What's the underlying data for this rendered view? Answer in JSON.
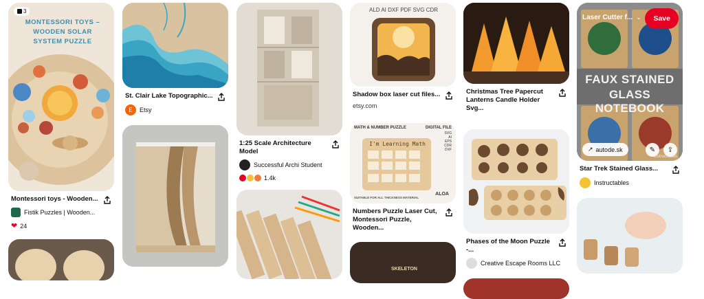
{
  "pins": [
    {
      "id": "montessori",
      "badge_count": "3",
      "image_text": "MONTESSORI TOYS – WOODEN SOLAR SYSTEM PUZZLE",
      "title": "Montessori toys - Wooden...",
      "source": "Fistik Puzzles | Wooden...",
      "reactions": "24"
    },
    {
      "id": "stclair",
      "title": "St. Clair Lake Topographic...",
      "source": "Etsy",
      "avatar_letter": "E"
    },
    {
      "id": "architecture",
      "title": "1:25 Scale Architecture Model",
      "source": "Successful Archi Student",
      "reactions": "1.4k"
    },
    {
      "id": "shadowbox",
      "image_text": "ALD AI DXF PDF SVG CDR",
      "title": "Shadow box laser cut files...",
      "url": "etsy.com"
    },
    {
      "id": "christmas",
      "title": "Christmas Tree Papercut Lanterns Candle Holder Svg..."
    },
    {
      "id": "startrek",
      "board_label": "Laser Cutter f...",
      "save_label": "Save",
      "image_text_1": "FAUX STAINED",
      "image_text_2": "GLASS NOTEBOOK",
      "link_label": "autode.sk",
      "watermark": "instructables",
      "title": "Star Trek Stained Glass...",
      "source": "Instructables"
    },
    {
      "id": "math",
      "image_text_header": "MATH & NUMBER PUZZLE",
      "image_text_digital": "DIGITAL FILE",
      "image_text_formats": "SVG AI EPS CDR DXF",
      "image_text_board": "I'm Learning Math",
      "image_text_footer": "SUITABLE FOR ALL THICKNESS MATERIAL",
      "image_text_brand": "ALOA",
      "title": "Numbers Puzzle Laser Cut, Montessori Puzzle, Wooden..."
    },
    {
      "id": "moon",
      "title": "Phases of the Moon Puzzle -...",
      "source": "Creative Escape Rooms LLC"
    },
    {
      "id": "skeleton",
      "image_text": "SKELETON"
    }
  ],
  "colors": {
    "save": "#e60023",
    "text": "#111111"
  }
}
